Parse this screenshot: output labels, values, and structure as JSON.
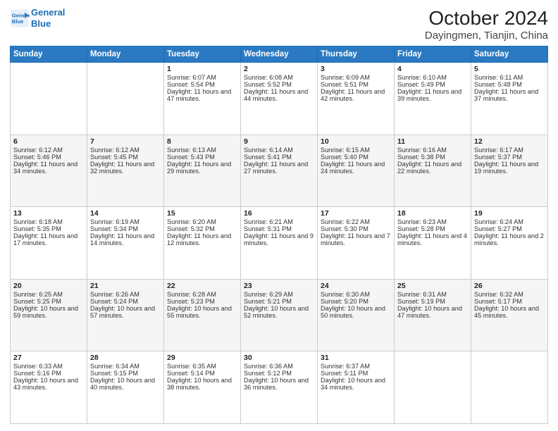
{
  "header": {
    "logo_line1": "General",
    "logo_line2": "Blue",
    "title": "October 2024",
    "subtitle": "Dayingmen, Tianjin, China"
  },
  "days_of_week": [
    "Sunday",
    "Monday",
    "Tuesday",
    "Wednesday",
    "Thursday",
    "Friday",
    "Saturday"
  ],
  "weeks": [
    [
      {
        "day": "",
        "sunrise": "",
        "sunset": "",
        "daylight": ""
      },
      {
        "day": "",
        "sunrise": "",
        "sunset": "",
        "daylight": ""
      },
      {
        "day": "1",
        "sunrise": "Sunrise: 6:07 AM",
        "sunset": "Sunset: 5:54 PM",
        "daylight": "Daylight: 11 hours and 47 minutes."
      },
      {
        "day": "2",
        "sunrise": "Sunrise: 6:08 AM",
        "sunset": "Sunset: 5:52 PM",
        "daylight": "Daylight: 11 hours and 44 minutes."
      },
      {
        "day": "3",
        "sunrise": "Sunrise: 6:09 AM",
        "sunset": "Sunset: 5:51 PM",
        "daylight": "Daylight: 11 hours and 42 minutes."
      },
      {
        "day": "4",
        "sunrise": "Sunrise: 6:10 AM",
        "sunset": "Sunset: 5:49 PM",
        "daylight": "Daylight: 11 hours and 39 minutes."
      },
      {
        "day": "5",
        "sunrise": "Sunrise: 6:11 AM",
        "sunset": "Sunset: 5:48 PM",
        "daylight": "Daylight: 11 hours and 37 minutes."
      }
    ],
    [
      {
        "day": "6",
        "sunrise": "Sunrise: 6:12 AM",
        "sunset": "Sunset: 5:46 PM",
        "daylight": "Daylight: 11 hours and 34 minutes."
      },
      {
        "day": "7",
        "sunrise": "Sunrise: 6:12 AM",
        "sunset": "Sunset: 5:45 PM",
        "daylight": "Daylight: 11 hours and 32 minutes."
      },
      {
        "day": "8",
        "sunrise": "Sunrise: 6:13 AM",
        "sunset": "Sunset: 5:43 PM",
        "daylight": "Daylight: 11 hours and 29 minutes."
      },
      {
        "day": "9",
        "sunrise": "Sunrise: 6:14 AM",
        "sunset": "Sunset: 5:41 PM",
        "daylight": "Daylight: 11 hours and 27 minutes."
      },
      {
        "day": "10",
        "sunrise": "Sunrise: 6:15 AM",
        "sunset": "Sunset: 5:40 PM",
        "daylight": "Daylight: 11 hours and 24 minutes."
      },
      {
        "day": "11",
        "sunrise": "Sunrise: 6:16 AM",
        "sunset": "Sunset: 5:38 PM",
        "daylight": "Daylight: 11 hours and 22 minutes."
      },
      {
        "day": "12",
        "sunrise": "Sunrise: 6:17 AM",
        "sunset": "Sunset: 5:37 PM",
        "daylight": "Daylight: 11 hours and 19 minutes."
      }
    ],
    [
      {
        "day": "13",
        "sunrise": "Sunrise: 6:18 AM",
        "sunset": "Sunset: 5:35 PM",
        "daylight": "Daylight: 11 hours and 17 minutes."
      },
      {
        "day": "14",
        "sunrise": "Sunrise: 6:19 AM",
        "sunset": "Sunset: 5:34 PM",
        "daylight": "Daylight: 11 hours and 14 minutes."
      },
      {
        "day": "15",
        "sunrise": "Sunrise: 6:20 AM",
        "sunset": "Sunset: 5:32 PM",
        "daylight": "Daylight: 11 hours and 12 minutes."
      },
      {
        "day": "16",
        "sunrise": "Sunrise: 6:21 AM",
        "sunset": "Sunset: 5:31 PM",
        "daylight": "Daylight: 11 hours and 9 minutes."
      },
      {
        "day": "17",
        "sunrise": "Sunrise: 6:22 AM",
        "sunset": "Sunset: 5:30 PM",
        "daylight": "Daylight: 11 hours and 7 minutes."
      },
      {
        "day": "18",
        "sunrise": "Sunrise: 6:23 AM",
        "sunset": "Sunset: 5:28 PM",
        "daylight": "Daylight: 11 hours and 4 minutes."
      },
      {
        "day": "19",
        "sunrise": "Sunrise: 6:24 AM",
        "sunset": "Sunset: 5:27 PM",
        "daylight": "Daylight: 11 hours and 2 minutes."
      }
    ],
    [
      {
        "day": "20",
        "sunrise": "Sunrise: 6:25 AM",
        "sunset": "Sunset: 5:25 PM",
        "daylight": "Daylight: 10 hours and 59 minutes."
      },
      {
        "day": "21",
        "sunrise": "Sunrise: 6:26 AM",
        "sunset": "Sunset: 5:24 PM",
        "daylight": "Daylight: 10 hours and 57 minutes."
      },
      {
        "day": "22",
        "sunrise": "Sunrise: 6:28 AM",
        "sunset": "Sunset: 5:23 PM",
        "daylight": "Daylight: 10 hours and 55 minutes."
      },
      {
        "day": "23",
        "sunrise": "Sunrise: 6:29 AM",
        "sunset": "Sunset: 5:21 PM",
        "daylight": "Daylight: 10 hours and 52 minutes."
      },
      {
        "day": "24",
        "sunrise": "Sunrise: 6:30 AM",
        "sunset": "Sunset: 5:20 PM",
        "daylight": "Daylight: 10 hours and 50 minutes."
      },
      {
        "day": "25",
        "sunrise": "Sunrise: 6:31 AM",
        "sunset": "Sunset: 5:19 PM",
        "daylight": "Daylight: 10 hours and 47 minutes."
      },
      {
        "day": "26",
        "sunrise": "Sunrise: 6:32 AM",
        "sunset": "Sunset: 5:17 PM",
        "daylight": "Daylight: 10 hours and 45 minutes."
      }
    ],
    [
      {
        "day": "27",
        "sunrise": "Sunrise: 6:33 AM",
        "sunset": "Sunset: 5:16 PM",
        "daylight": "Daylight: 10 hours and 43 minutes."
      },
      {
        "day": "28",
        "sunrise": "Sunrise: 6:34 AM",
        "sunset": "Sunset: 5:15 PM",
        "daylight": "Daylight: 10 hours and 40 minutes."
      },
      {
        "day": "29",
        "sunrise": "Sunrise: 6:35 AM",
        "sunset": "Sunset: 5:14 PM",
        "daylight": "Daylight: 10 hours and 38 minutes."
      },
      {
        "day": "30",
        "sunrise": "Sunrise: 6:36 AM",
        "sunset": "Sunset: 5:12 PM",
        "daylight": "Daylight: 10 hours and 36 minutes."
      },
      {
        "day": "31",
        "sunrise": "Sunrise: 6:37 AM",
        "sunset": "Sunset: 5:11 PM",
        "daylight": "Daylight: 10 hours and 34 minutes."
      },
      {
        "day": "",
        "sunrise": "",
        "sunset": "",
        "daylight": ""
      },
      {
        "day": "",
        "sunrise": "",
        "sunset": "",
        "daylight": ""
      }
    ]
  ]
}
